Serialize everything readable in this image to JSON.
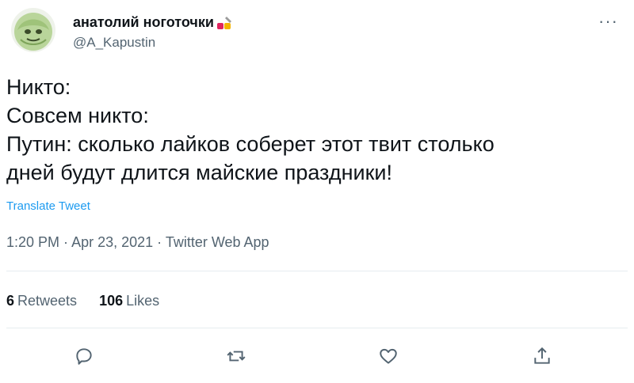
{
  "user": {
    "display_name": "анатолий ноготочки",
    "handle": "@A_Kapustin",
    "name_emoji": "nail-polish-emoji",
    "avatar_icon": "cabbage-avatar"
  },
  "tweet": {
    "lines": [
      "Никто:",
      "Совсем никто:",
      "Путин: сколько лайков соберет этот твит столько",
      "дней будут длится майские праздники!"
    ],
    "translate_label": "Translate Tweet",
    "time": "1:20 PM",
    "date": "Apr 23, 2021",
    "source": "Twitter Web App",
    "separator": " · "
  },
  "stats": {
    "retweets_count": "6",
    "retweets_label": "Retweets",
    "likes_count": "106",
    "likes_label": "Likes"
  },
  "actions": {
    "reply_icon": "reply-icon",
    "retweet_icon": "retweet-icon",
    "like_icon": "heart-icon",
    "share_icon": "share-icon"
  },
  "colors": {
    "text": "#0f1419",
    "muted": "#536471",
    "link": "#1d9bf0",
    "divider": "#e6ecf0"
  }
}
